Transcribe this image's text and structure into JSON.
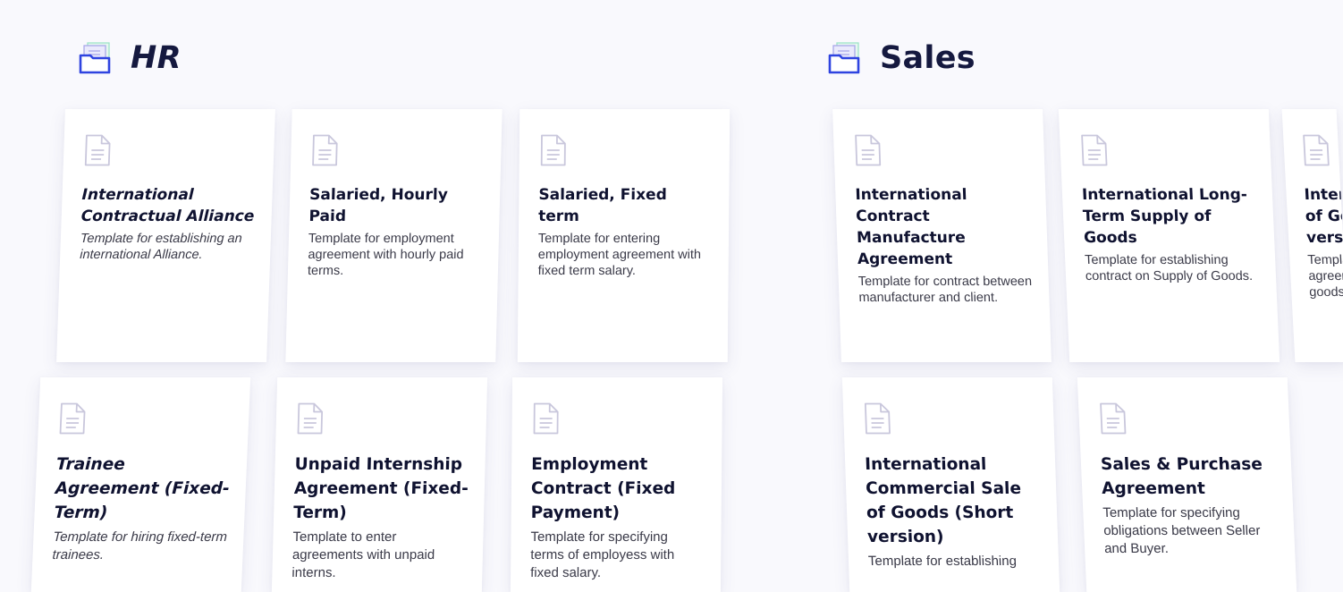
{
  "sections": [
    {
      "title": "HR",
      "icon": "folder-icon",
      "cards": [
        {
          "title": "International Contractual Alliance",
          "desc": "Template for establishing an international Alliance.",
          "icon": "document-icon"
        },
        {
          "title": "Salaried, Hourly Paid",
          "desc": "Template for employment agreement with hourly paid terms.",
          "icon": "document-icon"
        },
        {
          "title": "Salaried, Fixed term",
          "desc": "Template for entering employment agreement with fixed term salary.",
          "icon": "document-icon"
        },
        {
          "title": "Trainee Agreement (Fixed-Term)",
          "desc": "Template for hiring fixed-term trainees.",
          "icon": "document-icon"
        },
        {
          "title": "Unpaid Internship Agreement (Fixed-Term)",
          "desc": "Template to enter agreements with unpaid interns.",
          "icon": "document-icon"
        },
        {
          "title": "Employment Contract (Fixed Payment)",
          "desc": "Template for specifying terms of employess with fixed salary.",
          "icon": "document-icon"
        }
      ]
    },
    {
      "title": "Sales",
      "icon": "folder-icon",
      "cards": [
        {
          "title": "International Contract Manufacture Agreement",
          "desc": "Template for contract between manufacturer and client.",
          "icon": "document-icon"
        },
        {
          "title": "International Long-Term Supply of Goods",
          "desc": "Template for establishing contract on Supply of Goods.",
          "icon": "document-icon"
        },
        {
          "title": "International Sale of Goods (Short version)",
          "desc": "Template for establishing agreement on sale of goods.",
          "icon": "document-icon"
        },
        {
          "title": "International Commercial Sale of Goods (Short version)",
          "desc": "Template for establishing",
          "icon": "document-icon"
        },
        {
          "title": "Sales & Purchase Agreement",
          "desc": "Template for specifying obligations between Seller and Buyer.",
          "icon": "document-icon"
        }
      ]
    }
  ]
}
